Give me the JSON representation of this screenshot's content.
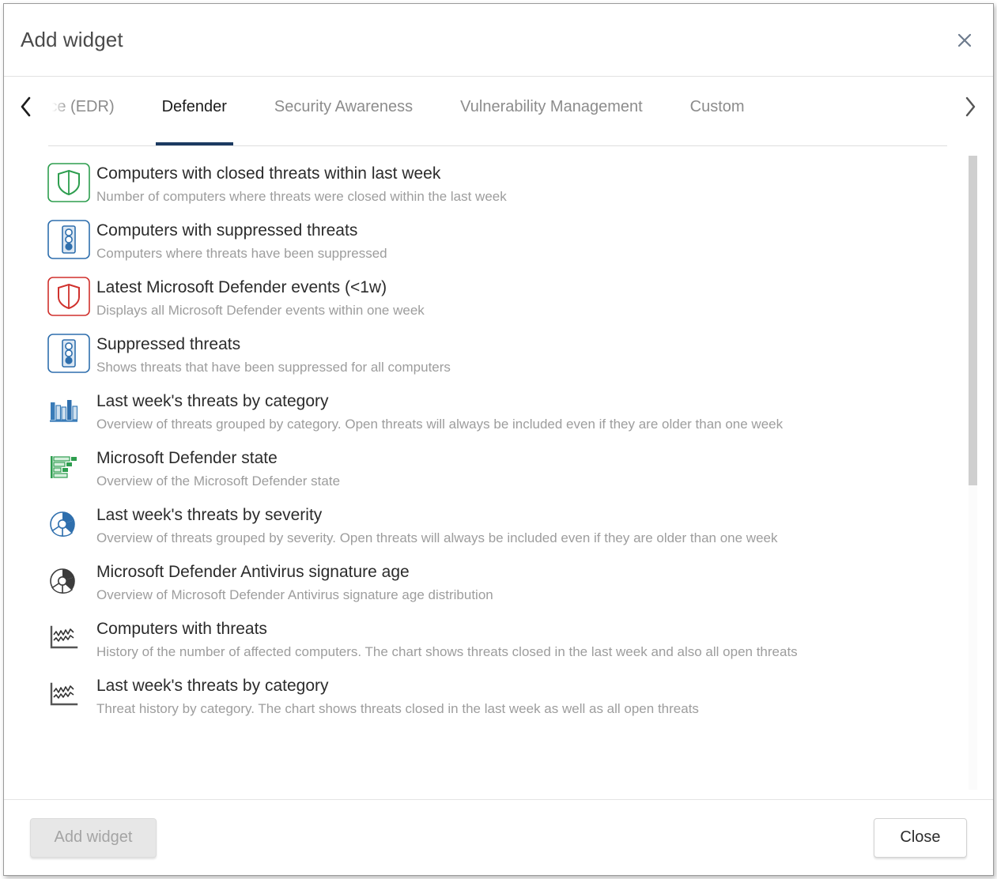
{
  "dialog": {
    "title": "Add widget",
    "close_icon": "close-icon"
  },
  "tabs": {
    "prev_icon": "chevron-left-icon",
    "next_icon": "chevron-right-icon",
    "items": [
      {
        "label": "& Compliance (EDR)",
        "active": false
      },
      {
        "label": "Defender",
        "active": true
      },
      {
        "label": "Security Awareness",
        "active": false
      },
      {
        "label": "Vulnerability Management",
        "active": false
      },
      {
        "label": "Custom",
        "active": false
      }
    ]
  },
  "widgets": [
    {
      "title": "Computers with closed threats within last week",
      "description": "Number of computers where threats were closed within the last week",
      "icon": "shield-boxed-green-icon",
      "icon_color": "#2e9e4f"
    },
    {
      "title": "Computers with suppressed threats",
      "description": "Computers where threats have been suppressed",
      "icon": "traffic-light-boxed-blue-icon",
      "icon_color": "#2f6fad"
    },
    {
      "title": "Latest Microsoft Defender events (<1w)",
      "description": "Displays all Microsoft Defender events within one week",
      "icon": "shield-boxed-red-icon",
      "icon_color": "#d0312d"
    },
    {
      "title": "Suppressed threats",
      "description": "Shows threats that have been suppressed for all computers",
      "icon": "traffic-light-boxed-blue-icon",
      "icon_color": "#2f6fad"
    },
    {
      "title": "Last week's threats by category",
      "description": "Overview of threats grouped by category. Open threats will always be included even if they are older than one week",
      "icon": "bar-chart-icon",
      "icon_color": "#2f6fad"
    },
    {
      "title": "Microsoft Defender state",
      "description": "Overview of the Microsoft Defender state",
      "icon": "horizontal-bar-chart-icon",
      "icon_color": "#2e9e4f"
    },
    {
      "title": "Last week's threats by severity",
      "description": "Overview of threats grouped by severity. Open threats will always be included even if they are older than one week",
      "icon": "donut-chart-blue-icon",
      "icon_color": "#2f6fad"
    },
    {
      "title": "Microsoft Defender Antivirus signature age",
      "description": "Overview of Microsoft Defender Antivirus signature age distribution",
      "icon": "donut-chart-gray-icon",
      "icon_color": "#3c3c3c"
    },
    {
      "title": "Computers with threats",
      "description": "History of the number of affected computers. The chart shows threats closed in the last week and also all open threats",
      "icon": "line-chart-icon",
      "icon_color": "#4a4a4a"
    },
    {
      "title": "Last week's threats by category",
      "description": "Threat history by category. The chart shows threats closed in the last week as well as all open threats",
      "icon": "line-chart-icon",
      "icon_color": "#4a4a4a"
    }
  ],
  "footer": {
    "add_widget_label": "Add widget",
    "close_label": "Close"
  },
  "scroll": {
    "thumb_top_pct": 0,
    "thumb_height_pct": 52
  },
  "colors": {
    "accent_tab_underline": "#1b3a61",
    "title_text": "#4a4a4a",
    "desc_text": "#9d9d9d",
    "green": "#2e9e4f",
    "blue": "#2f6fad",
    "red": "#d0312d",
    "dark": "#3c3c3c"
  }
}
